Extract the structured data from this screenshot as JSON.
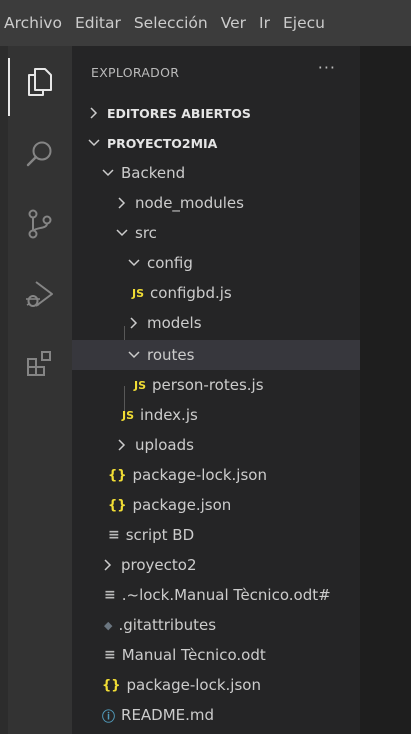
{
  "menubar": {
    "items": [
      "Archivo",
      "Editar",
      "Selección",
      "Ver",
      "Ir",
      "Ejecu"
    ]
  },
  "activitybar": {
    "icons": [
      "explorer-icon",
      "search-icon",
      "source-control-icon",
      "run-debug-icon",
      "extensions-icon"
    ]
  },
  "sidebar": {
    "title": "EXPLORADOR",
    "more": "···",
    "sections": {
      "open_editors": "EDITORES ABIERTOS",
      "project": "PROYECTO2MIA"
    },
    "tree": {
      "backend": "Backend",
      "node_modules": "node_modules",
      "src": "src",
      "config": "config",
      "configbd": "configbd.js",
      "models": "models",
      "routes": "routes",
      "person_rotes": "person-rotes.js",
      "index": "index.js",
      "uploads": "uploads",
      "package_lock_backend": "package-lock.json",
      "package_backend": "package.json",
      "script_bd": "script BD",
      "proyecto2": "proyecto2",
      "lock_manual": ".~lock.Manual Tècnico.odt#",
      "gitattributes": ".gitattributes",
      "manual": "Manual Tècnico.odt",
      "package_lock_root": "package-lock.json",
      "readme": "README.md"
    },
    "file_icons": {
      "js": "JS",
      "json": "{}",
      "lines": "≡",
      "info": "ⓘ",
      "diamond": "◆"
    }
  },
  "colors": {
    "menubar": "#3c3c3c",
    "activitybar": "#333333",
    "sidebar": "#252526",
    "selected_row": "#37373d",
    "js_icon": "#f1dd35",
    "info_icon": "#519aba"
  }
}
